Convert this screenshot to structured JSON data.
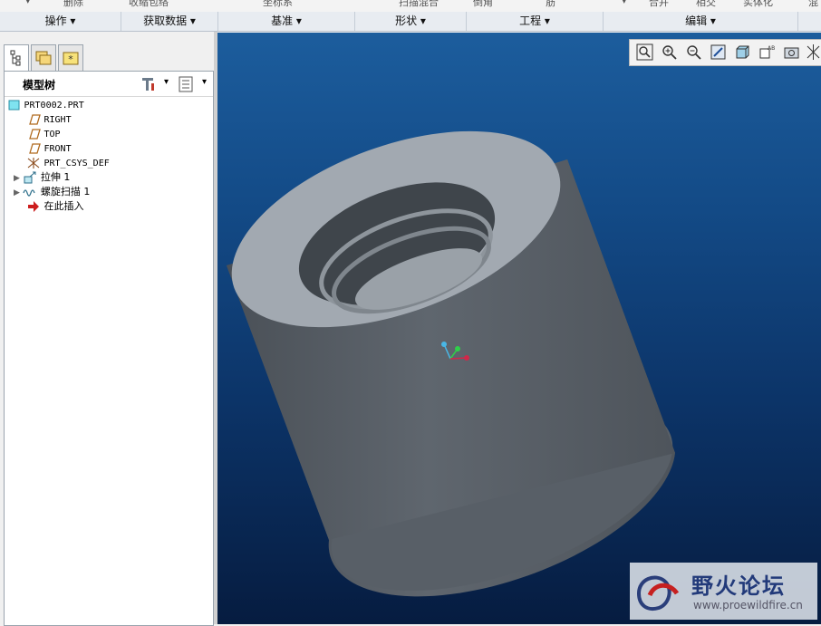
{
  "top_strip": {
    "items": [
      "删除",
      "收缩包络",
      "坐标系",
      "扫描混合",
      "倒角",
      "筋",
      "合并",
      "相交",
      "实体化",
      "混"
    ]
  },
  "ribbon": {
    "groups": [
      "操作 ▾",
      "获取数据 ▾",
      "基准 ▾",
      "形状 ▾",
      "工程 ▾",
      "编辑 ▾"
    ]
  },
  "model_tree": {
    "title": "模型树",
    "items": [
      {
        "label": "PRT0002.PRT",
        "icon": "part-icon"
      },
      {
        "label": "RIGHT",
        "icon": "datum-plane-icon"
      },
      {
        "label": "TOP",
        "icon": "datum-plane-icon"
      },
      {
        "label": "FRONT",
        "icon": "datum-plane-icon"
      },
      {
        "label": "PRT_CSYS_DEF",
        "icon": "coordinate-system-icon"
      },
      {
        "label": "拉伸 1",
        "icon": "extrude-icon"
      },
      {
        "label": "螺旋扫描 1",
        "icon": "helical-sweep-icon"
      },
      {
        "label": "在此插入",
        "icon": "insert-here-arrow-icon"
      }
    ]
  },
  "view_toolbar": {
    "buttons": [
      "zoom-fit-icon",
      "zoom-in-icon",
      "zoom-out-icon",
      "repaint-icon",
      "display-style-icon",
      "saved-views-icon",
      "view-manager-icon",
      "datum-display-icon"
    ]
  },
  "watermark": {
    "title": "野火论坛",
    "url": "www.proewildfire.cn"
  },
  "colors": {
    "viewport_top": "#1c5d9d",
    "viewport_bottom": "#061c40",
    "part_body": "#5c646d",
    "part_top_face": "#a2a9b1"
  }
}
